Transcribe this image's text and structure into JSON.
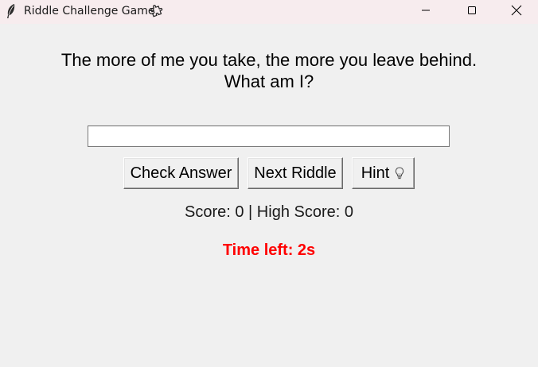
{
  "window": {
    "title": "Riddle Challenge Game",
    "icons": {
      "app": "feather-icon",
      "title_extra": "puzzle-icon",
      "minimize": "minimize-icon",
      "maximize": "maximize-icon",
      "close": "close-icon"
    }
  },
  "riddle": {
    "line1": "The more of me you take, the more you leave behind.",
    "line2": "What am I?"
  },
  "answer": {
    "value": "",
    "placeholder": ""
  },
  "buttons": {
    "check": "Check Answer",
    "next": "Next Riddle",
    "hint": "Hint",
    "hint_icon": "lightbulb-icon"
  },
  "status": {
    "score_text": "Score: 0 | High Score: 0",
    "timer_text": "Time left: 2s"
  },
  "colors": {
    "timer": "#ff0000",
    "titlebar": "#f7ecee",
    "background": "#f0f0f0"
  }
}
